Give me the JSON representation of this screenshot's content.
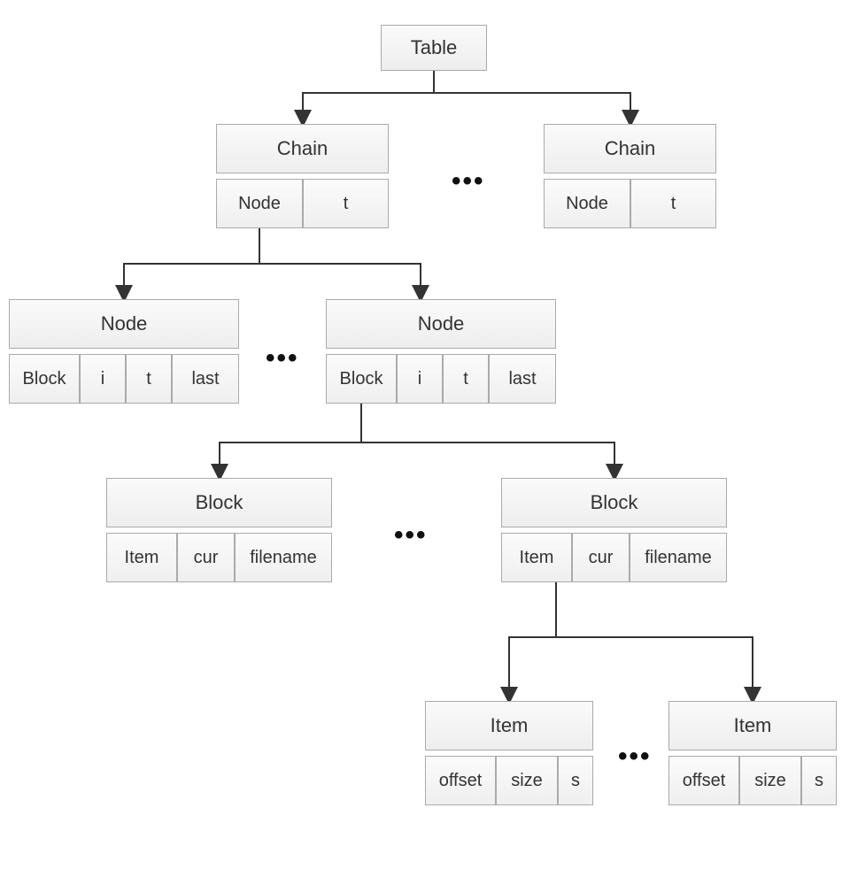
{
  "diagram": {
    "root": {
      "label": "Table"
    },
    "ellipsis": "•••",
    "chain": {
      "header": "Chain",
      "cells": [
        "Node",
        "t"
      ]
    },
    "node": {
      "header": "Node",
      "cells": [
        "Block",
        "i",
        "t",
        "last"
      ]
    },
    "block": {
      "header": "Block",
      "cells": [
        "Item",
        "cur",
        "filename"
      ]
    },
    "item": {
      "header": "Item",
      "cells": [
        "offset",
        "size",
        "s"
      ]
    }
  }
}
